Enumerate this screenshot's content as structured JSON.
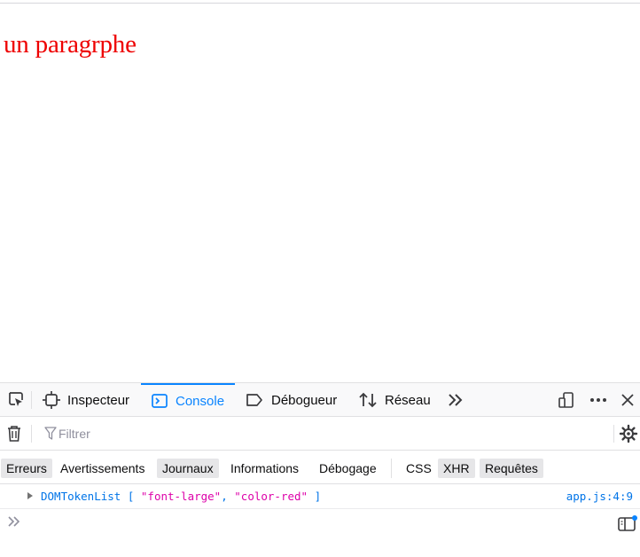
{
  "page": {
    "paragraph": "un paragrphe"
  },
  "devtools": {
    "tabs": [
      {
        "label": "Inspecteur",
        "icon": "inspector-icon"
      },
      {
        "label": "Console",
        "icon": "console-icon",
        "active": true
      },
      {
        "label": "Débogueur",
        "icon": "debugger-icon"
      },
      {
        "label": "Réseau",
        "icon": "network-icon"
      }
    ],
    "filter": {
      "placeholder": "Filtrer",
      "value": ""
    },
    "categories": [
      {
        "label": "Erreurs",
        "on": true
      },
      {
        "label": "Avertissements",
        "on": false
      },
      {
        "label": "Journaux",
        "on": true
      },
      {
        "label": "Informations",
        "on": false
      },
      {
        "label": "Débogage",
        "on": false
      },
      {
        "label": "CSS",
        "on": false
      },
      {
        "label": "XHR",
        "on": true
      },
      {
        "label": "Requêtes",
        "on": true
      }
    ],
    "message": {
      "prefix": "DOMTokenList [ ",
      "item1": "\"font-large\"",
      "sep": ", ",
      "item2": "\"color-red\"",
      "suffix": " ]",
      "source": "app.js:4:9"
    },
    "colors": {
      "accent": "#0a84ff",
      "paragraph": "#ee0000",
      "string": "#dd00a9",
      "object": "#0074e8"
    }
  }
}
